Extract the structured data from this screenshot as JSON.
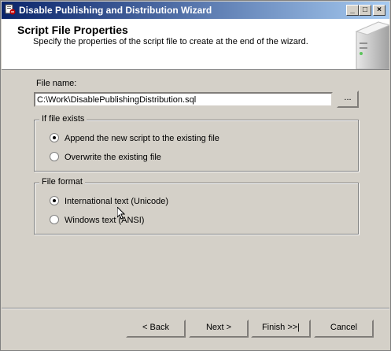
{
  "window": {
    "title": "Disable Publishing and Distribution Wizard"
  },
  "titlebar_buttons": {
    "minimize": "_",
    "maximize": "□",
    "close": "×"
  },
  "header": {
    "title": "Script File Properties",
    "subtitle": "Specify the properties of the script file to create at the end of the wizard."
  },
  "file": {
    "label": "File name:",
    "value": "C:\\Work\\DisablePublishingDistribution.sql",
    "browse_label": "..."
  },
  "if_exists": {
    "label": "If file exists",
    "options": [
      {
        "label": "Append the new script to the existing file",
        "selected": true
      },
      {
        "label": "Overwrite the existing file",
        "selected": false
      }
    ]
  },
  "file_format": {
    "label": "File format",
    "options": [
      {
        "label": "International text (Unicode)",
        "selected": true
      },
      {
        "label": "Windows text (ANSI)",
        "selected": false
      }
    ]
  },
  "buttons": {
    "back": "< Back",
    "next": "Next >",
    "finish": "Finish >>|",
    "cancel": "Cancel"
  },
  "colors": {
    "titlebar_start": "#0a246a",
    "titlebar_end": "#a6caf0",
    "face": "#d4d0c8"
  },
  "icons": {
    "app": "wizard-app-icon",
    "header": "server-graphic"
  }
}
